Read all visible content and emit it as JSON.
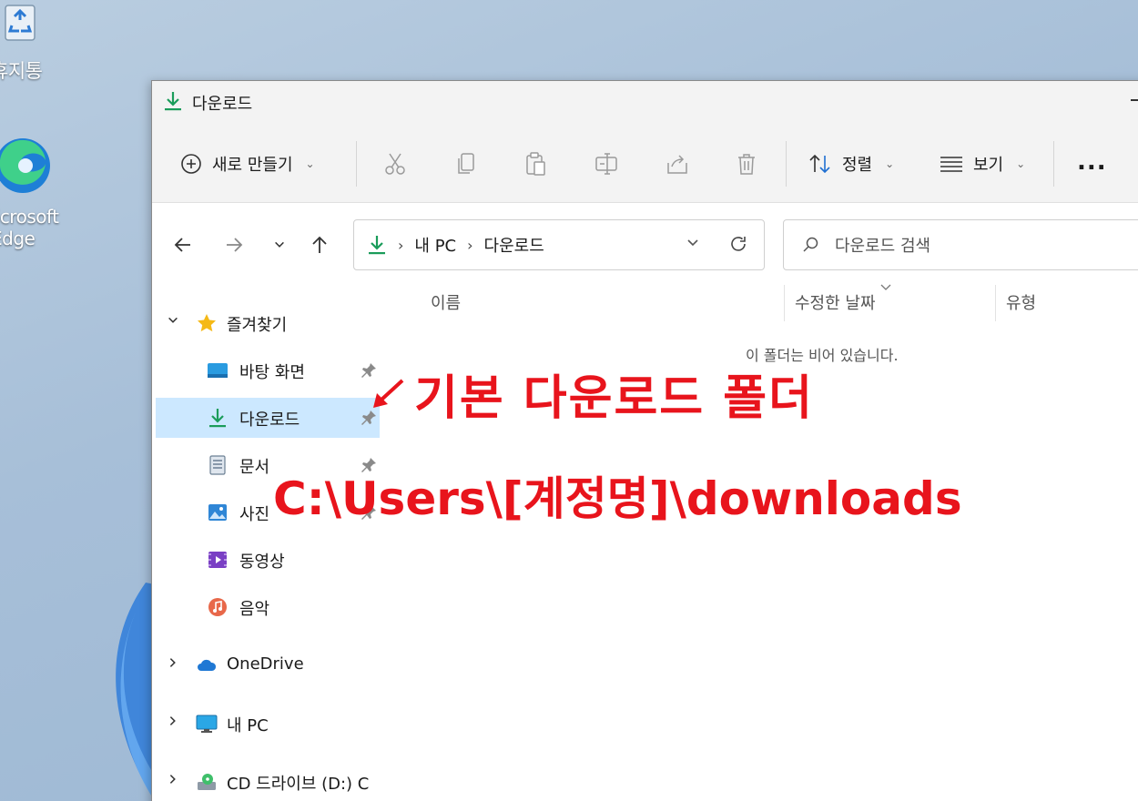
{
  "desktop": {
    "recycle_label": "휴지통",
    "edge_label_1": "Microsoft",
    "edge_label_2": "Edge"
  },
  "window": {
    "title": "다운로드"
  },
  "toolbar": {
    "new_label": "새로 만들기",
    "sort_label": "정렬",
    "view_label": "보기",
    "more_label": "..."
  },
  "address": {
    "crumbs": [
      "내 PC",
      "다운로드"
    ]
  },
  "search": {
    "placeholder": "다운로드 검색"
  },
  "sidebar": {
    "quick_access": "즐겨찾기",
    "items": [
      {
        "label": "바탕 화면"
      },
      {
        "label": "다운로드"
      },
      {
        "label": "문서"
      },
      {
        "label": "사진"
      },
      {
        "label": "동영상"
      },
      {
        "label": "음악"
      }
    ],
    "onedrive": "OneDrive",
    "this_pc": "내 PC",
    "cd_drive": "CD 드라이브 (D:) C"
  },
  "columns": {
    "name": "이름",
    "modified": "수정한 날짜",
    "type": "유형"
  },
  "content": {
    "empty_message": "이 폴더는 비어 있습니다."
  },
  "annotation": {
    "title": "기본 다운로드 폴더",
    "path": "C:\\Users\\[계정명]\\downloads"
  },
  "colors": {
    "accent_green": "#1a9c5a",
    "selection": "#cce8ff",
    "annotation_red": "#e8141c"
  }
}
